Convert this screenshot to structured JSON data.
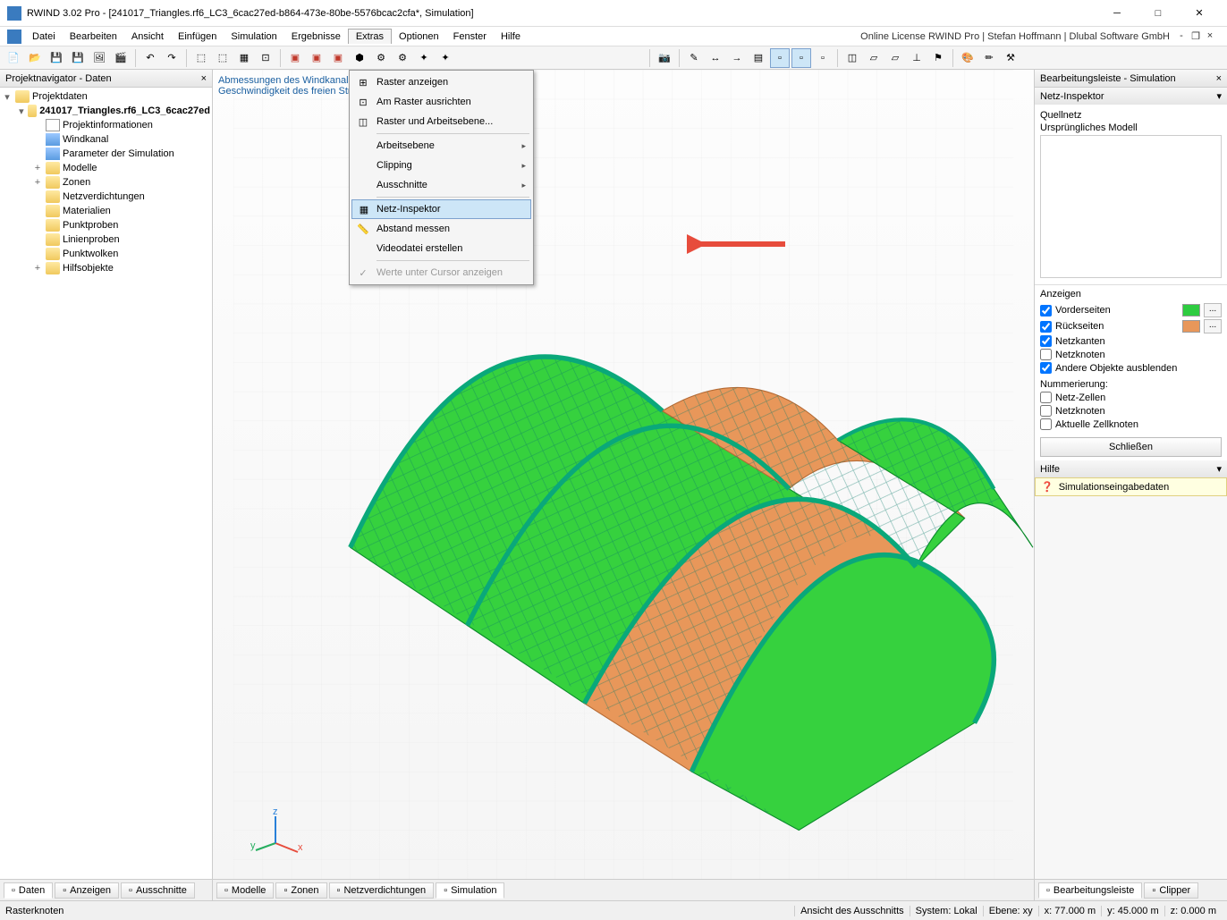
{
  "window": {
    "title": "RWIND 3.02 Pro - [241017_Triangles.rf6_LC3_6cac27ed-b864-473e-80be-5576bcac2cfa*, Simulation]",
    "license": "Online License RWIND Pro | Stefan Hoffmann | Dlubal Software GmbH"
  },
  "menu": {
    "items": [
      "Datei",
      "Bearbeiten",
      "Ansicht",
      "Einfügen",
      "Simulation",
      "Ergebnisse",
      "Extras",
      "Optionen",
      "Fenster",
      "Hilfe"
    ]
  },
  "dropdown": {
    "items": [
      {
        "label": "Raster anzeigen",
        "icon": "grid-icon"
      },
      {
        "label": "Am Raster ausrichten",
        "icon": "snap-icon"
      },
      {
        "label": "Raster und Arbeitsebene...",
        "icon": "plane-icon"
      },
      {
        "sep": true
      },
      {
        "label": "Arbeitsebene",
        "sub": true
      },
      {
        "label": "Clipping",
        "sub": true
      },
      {
        "label": "Ausschnitte",
        "sub": true
      },
      {
        "sep": true
      },
      {
        "label": "Netz-Inspektor",
        "icon": "mesh-icon",
        "highlight": true
      },
      {
        "label": "Abstand messen",
        "icon": "measure-icon"
      },
      {
        "label": "Videodatei erstellen"
      },
      {
        "sep": true
      },
      {
        "label": "Werte unter Cursor anzeigen",
        "icon": "check-icon",
        "disabled": true
      }
    ]
  },
  "navigator": {
    "title": "Projektnavigator - Daten",
    "root": "Projektdaten",
    "project": "241017_Triangles.rf6_LC3_6cac27ed",
    "items": [
      {
        "label": "Projektinformationen",
        "icon": "doc"
      },
      {
        "label": "Windkanal",
        "icon": "param"
      },
      {
        "label": "Parameter der Simulation",
        "icon": "param"
      },
      {
        "label": "Modelle",
        "icon": "folder",
        "exp": true
      },
      {
        "label": "Zonen",
        "icon": "folder",
        "exp": true
      },
      {
        "label": "Netzverdichtungen",
        "icon": "folder"
      },
      {
        "label": "Materialien",
        "icon": "folder"
      },
      {
        "label": "Punktproben",
        "icon": "folder"
      },
      {
        "label": "Linienproben",
        "icon": "folder"
      },
      {
        "label": "Punktwolken",
        "icon": "folder"
      },
      {
        "label": "Hilfsobjekte",
        "icon": "folder",
        "exp": true
      }
    ]
  },
  "viewportInfo": {
    "line1": "Abmessungen des Windkanals:",
    "line2": "Geschwindigkeit des freien Stro"
  },
  "editbar": {
    "title": "Bearbeitungsleiste - Simulation",
    "section": "Netz-Inspektor",
    "field1": "Quellnetz",
    "field2": "Ursprüngliches Modell",
    "display": "Anzeigen",
    "front": "Vorderseiten",
    "back": "Rückseiten",
    "edges": "Netzkanten",
    "nodes": "Netzknoten",
    "hide": "Andere Objekte ausblenden",
    "numbering": "Nummerierung:",
    "cells": "Netz-Zellen",
    "nodes2": "Netzknoten",
    "cellnodes": "Aktuelle Zellknoten",
    "close": "Schließen",
    "help": "Hilfe",
    "helpLink": "Simulationseingabedaten",
    "frontColor": "#2ecc40",
    "backColor": "#e8975a"
  },
  "bottomLeft": [
    "Daten",
    "Anzeigen",
    "Ausschnitte"
  ],
  "bottomCenter": [
    "Modelle",
    "Zonen",
    "Netzverdichtungen",
    "Simulation"
  ],
  "bottomRight": [
    "Bearbeitungsleiste",
    "Clipper"
  ],
  "status": {
    "left": "Rasterknoten",
    "view": "Ansicht des Ausschnitts",
    "system": "System: Lokal",
    "plane": "Ebene: xy",
    "x": "x: 77.000 m",
    "y": "y: 45.000 m",
    "z": "z: 0.000 m"
  }
}
